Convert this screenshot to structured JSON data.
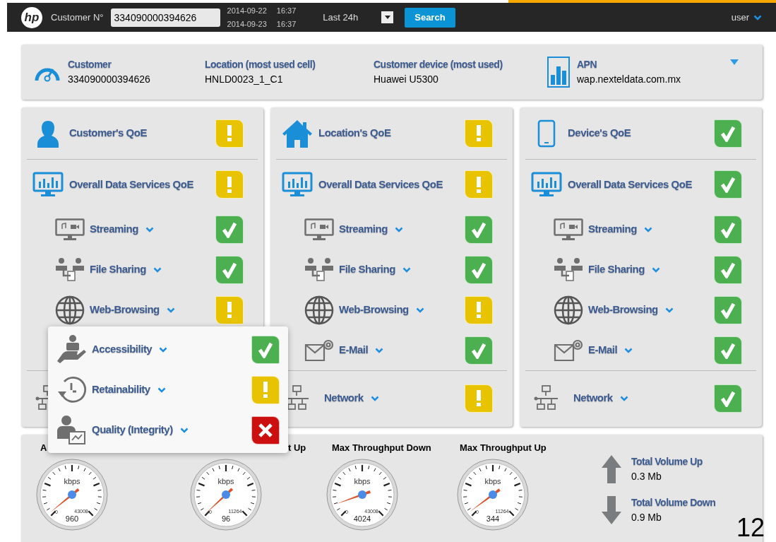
{
  "top_bar": {
    "logo_text": "hp",
    "customer_label": "Customer N°",
    "customer_value": "334090000394626",
    "range_start": {
      "date": "2014-09-22",
      "time": "16:37"
    },
    "range_end": {
      "date": "2014-09-23",
      "time": "16:37"
    },
    "period": "Last 24h",
    "search_button": "Search",
    "user": "user"
  },
  "summary": [
    {
      "kind": "customer",
      "label": "Customer",
      "value": "334090000394626"
    },
    {
      "kind": "location",
      "label": "Location (most used cell)",
      "value": "HNLD0023_1_C1"
    },
    {
      "kind": "device",
      "label": "Customer device (most used)",
      "value": "Huawei U5300"
    },
    {
      "kind": "apn",
      "label": "APN",
      "value": "wap.nexteldata.com.mx"
    }
  ],
  "panels": [
    {
      "kind": "customer",
      "title": "Customer's QoE",
      "status": {
        "kind": "warn"
      },
      "overall": {
        "label": "Overall Data Services QoE",
        "status": {
          "kind": "warn"
        }
      },
      "services": [
        {
          "kind": "streaming",
          "label": "Streaming",
          "status": {
            "kind": "ok"
          }
        },
        {
          "kind": "file-sharing",
          "label": "File Sharing",
          "status": {
            "kind": "ok"
          }
        },
        {
          "kind": "web-browsing",
          "label": "Web-Browsing",
          "status": {
            "kind": "warn"
          }
        }
      ],
      "network": {
        "kind": "network"
      }
    },
    {
      "kind": "location",
      "title": "Location's QoE",
      "status": {
        "kind": "warn"
      },
      "overall": {
        "label": "Overall Data Services QoE",
        "status": {
          "kind": "warn"
        }
      },
      "services": [
        {
          "kind": "streaming",
          "label": "Streaming",
          "status": {
            "kind": "ok"
          }
        },
        {
          "kind": "file-sharing",
          "label": "File Sharing",
          "status": {
            "kind": "ok"
          }
        },
        {
          "kind": "web-browsing",
          "label": "Web-Browsing",
          "status": {
            "kind": "warn"
          }
        },
        {
          "kind": "email",
          "label": "E-Mail",
          "status": {
            "kind": "ok"
          }
        }
      ],
      "network": {
        "kind": "network",
        "label": "Network",
        "status": {
          "kind": "warn"
        }
      }
    },
    {
      "kind": "device",
      "title": "Device's QoE",
      "status": {
        "kind": "ok"
      },
      "overall": {
        "label": "Overall Data Services QoE",
        "status": {
          "kind": "ok"
        }
      },
      "services": [
        {
          "kind": "streaming",
          "label": "Streaming",
          "status": {
            "kind": "ok"
          }
        },
        {
          "kind": "file-sharing",
          "label": "File Sharing",
          "status": {
            "kind": "ok"
          }
        },
        {
          "kind": "web-browsing",
          "label": "Web-Browsing",
          "status": {
            "kind": "ok"
          }
        },
        {
          "kind": "email",
          "label": "E-Mail",
          "status": {
            "kind": "ok"
          }
        }
      ],
      "network": {
        "kind": "network",
        "label": "Network",
        "status": {
          "kind": "ok"
        }
      }
    }
  ],
  "popup": [
    {
      "kind": "accessibility",
      "label": "Accessibility",
      "status": {
        "kind": "ok"
      }
    },
    {
      "kind": "retainability",
      "label": "Retainability",
      "status": {
        "kind": "warn"
      }
    },
    {
      "kind": "quality",
      "label": "Quality (Integrity)",
      "status": {
        "kind": "error"
      }
    }
  ],
  "gauges": [
    {
      "label": "A",
      "unit": "kbps",
      "min": "0",
      "max": "43008",
      "value": "960"
    },
    {
      "label": "t Up",
      "unit": "kbps",
      "min": "0",
      "max": "11264",
      "value": "96"
    },
    {
      "label": "Max Throughput Down",
      "unit": "kbps",
      "min": "0",
      "max": "43008",
      "value": "4024"
    },
    {
      "label": "Max Throughput Up",
      "unit": "kbps",
      "min": "0",
      "max": "11264",
      "value": "344"
    }
  ],
  "volumes": [
    {
      "kind": "up",
      "label": "Total Volume Up",
      "value": "0.3 Mb"
    },
    {
      "kind": "down",
      "label": "Total Volume Down",
      "value": "0.9 Mb"
    }
  ],
  "page_number": "12"
}
